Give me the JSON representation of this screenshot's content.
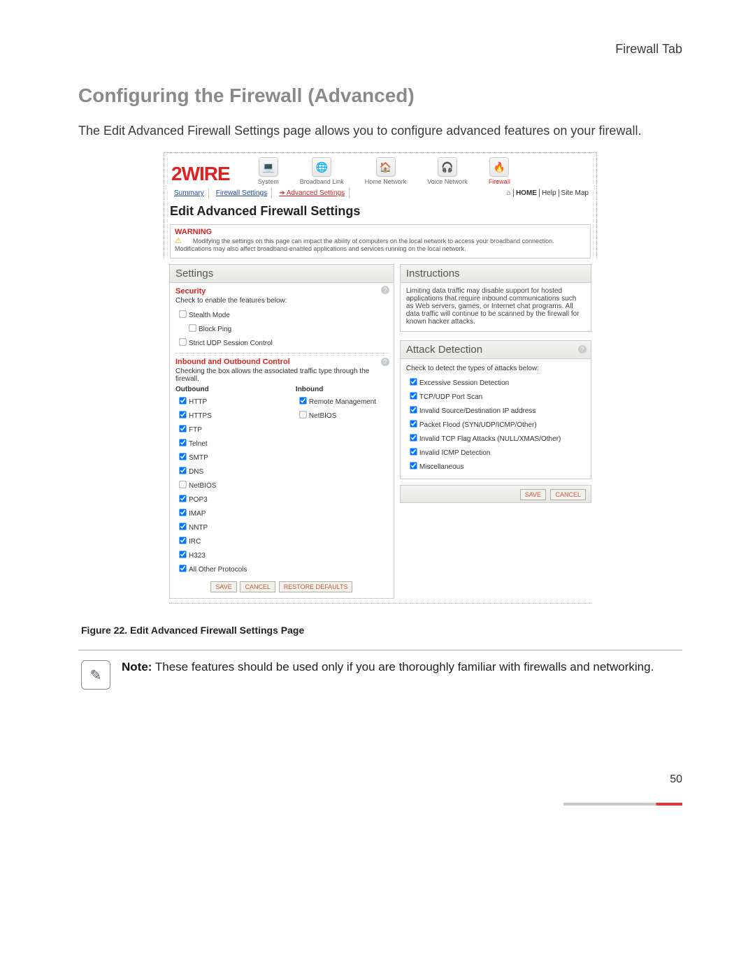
{
  "doc": {
    "tab_label": "Firewall Tab",
    "heading": "Configuring the Firewall (Advanced)",
    "intro": "The Edit Advanced Firewall Settings page allows you to configure advanced features on your firewall.",
    "caption": "Figure 22. Edit Advanced Firewall Settings Page",
    "note_label": "Note:",
    "note_text": " These features should be used only if you are thoroughly familiar with firewalls and networking.",
    "page_number": "50"
  },
  "ui": {
    "brand": "2WIRE",
    "nav": [
      {
        "label": "System"
      },
      {
        "label": "Broadband Link"
      },
      {
        "label": "Home Network"
      },
      {
        "label": "Voice Network"
      },
      {
        "label": "Firewall",
        "active": true
      }
    ],
    "tabs": {
      "summary": "Summary",
      "settings": "Firewall Settings",
      "advanced": "Advanced Settings"
    },
    "home_links": {
      "home": "HOME",
      "help": "Help",
      "sitemap": "Site Map"
    },
    "page_title": "Edit Advanced Firewall Settings",
    "warning": {
      "title": "WARNING",
      "text": "Modifying the settings on this page can impact the ability of computers on the local network to access your broadband connection. Modifications may also affect broadband-enabled applications and services running on the local network."
    },
    "settings_head": "Settings",
    "security": {
      "title": "Security",
      "sub": "Check to enable the features below:",
      "items": [
        {
          "label": "Stealth Mode",
          "checked": false,
          "indent": 0
        },
        {
          "label": "Block Ping",
          "checked": false,
          "indent": 1
        },
        {
          "label": "Strict UDP Session Control",
          "checked": false,
          "indent": 0
        }
      ]
    },
    "inout": {
      "title": "Inbound and Outbound Control",
      "sub": "Checking the box allows the associated traffic type through the firewall.",
      "out_label": "Outbound",
      "in_label": "Inbound",
      "outbound": [
        {
          "label": "HTTP",
          "checked": true
        },
        {
          "label": "HTTPS",
          "checked": true
        },
        {
          "label": "FTP",
          "checked": true
        },
        {
          "label": "Telnet",
          "checked": true
        },
        {
          "label": "SMTP",
          "checked": true
        },
        {
          "label": "DNS",
          "checked": true
        },
        {
          "label": "NetBIOS",
          "checked": false
        },
        {
          "label": "POP3",
          "checked": true
        },
        {
          "label": "IMAP",
          "checked": true
        },
        {
          "label": "NNTP",
          "checked": true
        },
        {
          "label": "IRC",
          "checked": true
        },
        {
          "label": "H323",
          "checked": true
        },
        {
          "label": "All Other Protocols",
          "checked": true
        }
      ],
      "inbound": [
        {
          "label": "Remote Management",
          "checked": true
        },
        {
          "label": "NetBIOS",
          "checked": false
        }
      ]
    },
    "buttons": {
      "save": "SAVE",
      "cancel": "CANCEL",
      "restore": "RESTORE DEFAULTS"
    },
    "instructions_head": "Instructions",
    "instructions_text": "Limiting data traffic may disable support for hosted applications that require inbound communications such as Web servers, games, or Internet chat programs. All data traffic will continue to be scanned by the firewall for known hacker attacks.",
    "attack_head": "Attack Detection",
    "attack_sub": "Check to detect the types of attacks below:",
    "attack_items": [
      {
        "label": "Excessive Session Detection",
        "checked": true
      },
      {
        "label": "TCP/UDP Port Scan",
        "checked": true
      },
      {
        "label": "Invalid Source/Destination IP address",
        "checked": true
      },
      {
        "label": "Packet Flood (SYN/UDP/ICMP/Other)",
        "checked": true
      },
      {
        "label": "Invalid TCP Flag Attacks (NULL/XMAS/Other)",
        "checked": true
      },
      {
        "label": "Invalid ICMP Detection",
        "checked": true
      },
      {
        "label": "Miscellaneous",
        "checked": true
      }
    ]
  }
}
